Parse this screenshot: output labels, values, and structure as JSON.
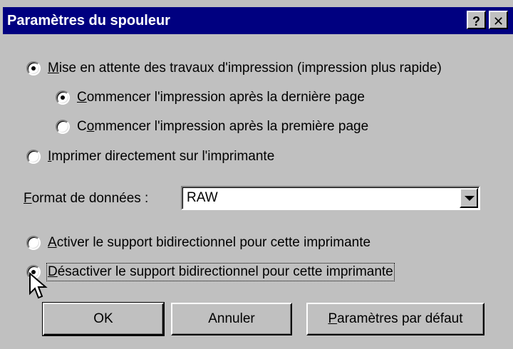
{
  "window": {
    "title": "Paramètres du spouleur",
    "help_label": "?",
    "close_label": "✕"
  },
  "options": {
    "spool": {
      "label_mnemonic": "M",
      "label_rest": "ise en attente des travaux d'impression (impression plus rapide)",
      "checked": true
    },
    "after_last": {
      "label_mnemonic": "C",
      "label_rest": "ommencer l'impression après la dernière page",
      "checked": true
    },
    "after_first": {
      "label_pre": "C",
      "label_mnemonic": "o",
      "label_rest": "mmencer l'impression après la première page",
      "checked": false
    },
    "direct": {
      "label_mnemonic": "I",
      "label_rest": "mprimer directement sur l'imprimante",
      "checked": false
    }
  },
  "format": {
    "label_mnemonic": "F",
    "label_rest": "ormat de données :",
    "value": "RAW"
  },
  "bidi": {
    "enable": {
      "label_mnemonic": "A",
      "label_rest": "ctiver le support bidirectionnel pour cette imprimante",
      "checked": false
    },
    "disable": {
      "label_mnemonic": "D",
      "label_rest": "ésactiver le support bidirectionnel pour cette imprimante",
      "checked": true
    }
  },
  "buttons": {
    "ok": "OK",
    "cancel": "Annuler",
    "defaults_mnemonic": "P",
    "defaults_rest": "aramètres par défaut"
  },
  "icons": {
    "cursor": "arrow-cursor-icon",
    "help": "help-icon",
    "close": "close-icon",
    "dropdown": "chevron-down-icon"
  }
}
